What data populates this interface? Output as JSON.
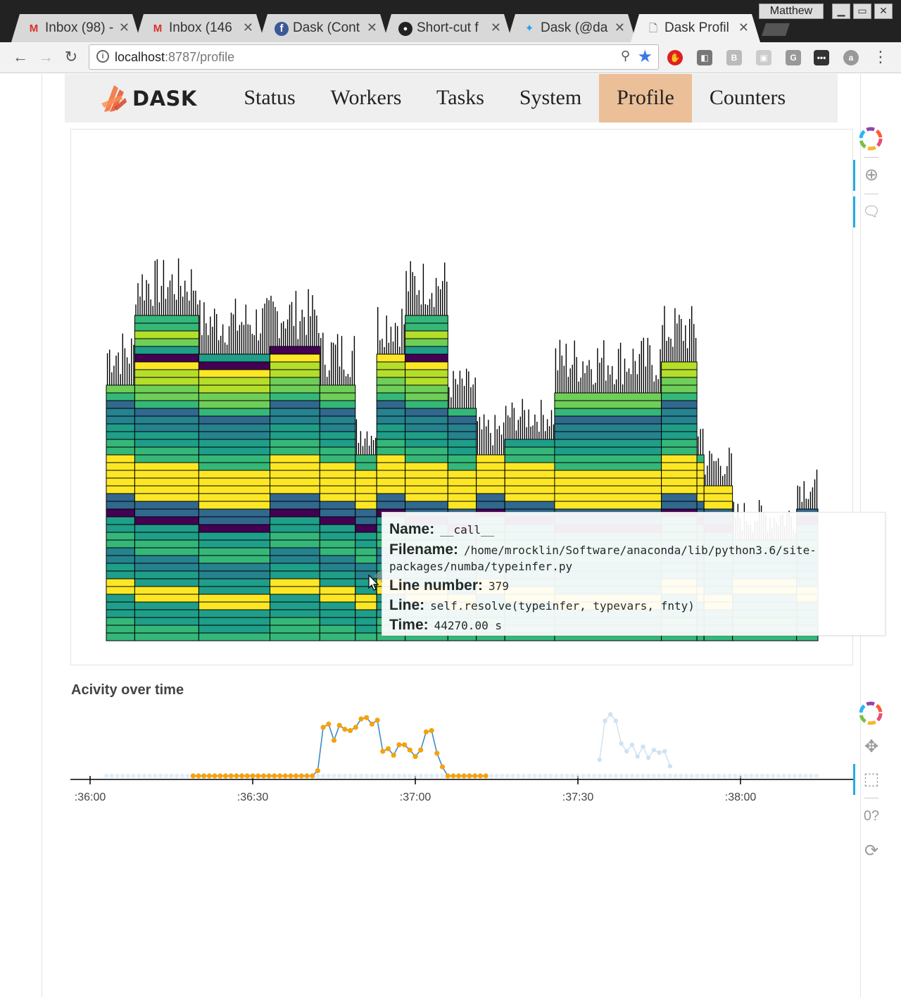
{
  "browser": {
    "user_profile": "Matthew",
    "tabs": [
      {
        "title": "Inbox (98) -",
        "icon": "gmail-icon"
      },
      {
        "title": "Inbox (146",
        "icon": "gmail-icon"
      },
      {
        "title": "Dask (Cont",
        "icon": "facebook-icon"
      },
      {
        "title": "Short-cut f",
        "icon": "github-icon"
      },
      {
        "title": "Dask (@da",
        "icon": "twitter-icon"
      },
      {
        "title": "Dask Profil",
        "icon": "page-icon",
        "active": true
      }
    ],
    "url_host": "localhost",
    "url_path": ":8787/profile"
  },
  "navbar": {
    "brand": "DASK",
    "links": [
      {
        "label": "Status",
        "active": false
      },
      {
        "label": "Workers",
        "active": false
      },
      {
        "label": "Tasks",
        "active": false
      },
      {
        "label": "System",
        "active": false
      },
      {
        "label": "Profile",
        "active": true
      },
      {
        "label": "Counters",
        "active": false
      }
    ]
  },
  "tooltip": {
    "name_label": "Name:",
    "name": "__call__",
    "filename_label": "Filename:",
    "filename": "/home/mrocklin/Software/anaconda/lib/python3.6/site-packages/numba/typeinfer.py",
    "line_number_label": "Line number:",
    "line_number": "379",
    "line_label": "Line:",
    "line": "self.resolve(typeinfer, typevars, fnty)",
    "time_label": "Time:",
    "time": "44270.00 s"
  },
  "activity": {
    "title": "Acivity over time"
  },
  "colors": {
    "viridis": [
      "#440154",
      "#3e4a89",
      "#31688e",
      "#26828e",
      "#1f9e89",
      "#35b779",
      "#6ece58",
      "#b5de2b",
      "#fde725"
    ],
    "selected_point": "#f5a20d",
    "line": "#3d8bc9",
    "active_nav": "#ebbf97"
  },
  "chart_data": [
    {
      "type": "flame",
      "description_values": "profile of stacked call frames",
      "columns": [
        {
          "x0": 0.0,
          "x1": 0.04,
          "depth": 33
        },
        {
          "x0": 0.04,
          "x1": 0.13,
          "depth": 42
        },
        {
          "x0": 0.13,
          "x1": 0.23,
          "depth": 37
        },
        {
          "x0": 0.23,
          "x1": 0.3,
          "depth": 38
        },
        {
          "x0": 0.3,
          "x1": 0.35,
          "depth": 33
        },
        {
          "x0": 0.35,
          "x1": 0.38,
          "depth": 24
        },
        {
          "x0": 0.38,
          "x1": 0.42,
          "depth": 37
        },
        {
          "x0": 0.42,
          "x1": 0.48,
          "depth": 42
        },
        {
          "x0": 0.48,
          "x1": 0.52,
          "depth": 30
        },
        {
          "x0": 0.52,
          "x1": 0.56,
          "depth": 24
        },
        {
          "x0": 0.56,
          "x1": 0.63,
          "depth": 26
        },
        {
          "x0": 0.63,
          "x1": 0.78,
          "depth": 32
        },
        {
          "x0": 0.78,
          "x1": 0.83,
          "depth": 36
        },
        {
          "x0": 0.83,
          "x1": 0.84,
          "depth": 24
        },
        {
          "x0": 0.84,
          "x1": 0.88,
          "depth": 20
        },
        {
          "x0": 0.88,
          "x1": 0.97,
          "depth": 13
        },
        {
          "x0": 0.97,
          "x1": 1.0,
          "depth": 17
        }
      ]
    },
    {
      "type": "scatter",
      "x_ticks": [
        ":36:00",
        ":36:30",
        ":37:00",
        ":37:30",
        ":38:00"
      ],
      "selected_series": [
        [
          "36:19",
          0
        ],
        [
          "36:20",
          0
        ],
        [
          "36:21",
          0
        ],
        [
          "36:22",
          0
        ],
        [
          "36:23",
          0
        ],
        [
          "36:24",
          0
        ],
        [
          "36:25",
          0
        ],
        [
          "36:26",
          0
        ],
        [
          "36:27",
          0
        ],
        [
          "36:28",
          0
        ],
        [
          "36:29",
          0
        ],
        [
          "36:30",
          0
        ],
        [
          "36:31",
          0
        ],
        [
          "36:32",
          0
        ],
        [
          "36:33",
          0
        ],
        [
          "36:34",
          0
        ],
        [
          "36:35",
          0
        ],
        [
          "36:36",
          0
        ],
        [
          "36:37",
          0
        ],
        [
          "36:38",
          0
        ],
        [
          "36:39",
          0
        ],
        [
          "36:40",
          0
        ],
        [
          "36:41",
          0
        ],
        [
          "36:42",
          8
        ],
        [
          "36:43",
          75
        ],
        [
          "36:44",
          80
        ],
        [
          "36:45",
          55
        ],
        [
          "36:46",
          78
        ],
        [
          "36:47",
          72
        ],
        [
          "36:48",
          70
        ],
        [
          "36:49",
          75
        ],
        [
          "36:50",
          88
        ],
        [
          "36:51",
          90
        ],
        [
          "36:52",
          80
        ],
        [
          "36:53",
          86
        ],
        [
          "36:54",
          38
        ],
        [
          "36:55",
          42
        ],
        [
          "36:56",
          32
        ],
        [
          "36:57",
          48
        ],
        [
          "36:58",
          48
        ],
        [
          "36:59",
          40
        ],
        [
          "37:00",
          30
        ],
        [
          "37:01",
          40
        ],
        [
          "37:02",
          68
        ],
        [
          "37:03",
          70
        ],
        [
          "37:04",
          35
        ],
        [
          "37:05",
          14
        ],
        [
          "37:06",
          0
        ],
        [
          "37:07",
          0
        ],
        [
          "37:08",
          0
        ],
        [
          "37:09",
          0
        ],
        [
          "37:10",
          0
        ],
        [
          "37:11",
          0
        ],
        [
          "37:12",
          0
        ],
        [
          "37:13",
          0
        ]
      ],
      "unselected_series": [
        [
          "37:34",
          25
        ],
        [
          "37:35",
          85
        ],
        [
          "37:36",
          95
        ],
        [
          "37:37",
          85
        ],
        [
          "37:38",
          50
        ],
        [
          "37:39",
          38
        ],
        [
          "37:40",
          48
        ],
        [
          "37:41",
          30
        ],
        [
          "37:42",
          45
        ],
        [
          "37:43",
          28
        ],
        [
          "37:44",
          40
        ],
        [
          "37:45",
          36
        ],
        [
          "37:46",
          38
        ],
        [
          "37:47",
          15
        ]
      ]
    }
  ]
}
